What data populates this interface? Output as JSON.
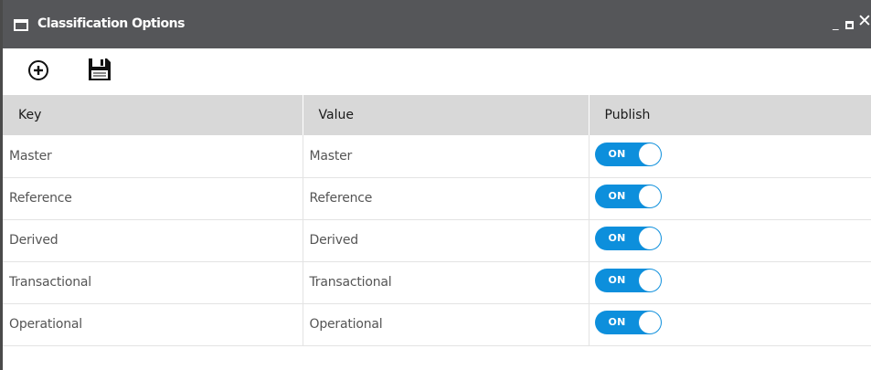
{
  "window": {
    "title": "Classification Options"
  },
  "toolbar": {
    "add_icon": "add-circle-icon",
    "save_icon": "floppy-disk-save-icon"
  },
  "table": {
    "columns": [
      "Key",
      "Value",
      "Publish"
    ],
    "rows": [
      {
        "key": "Master",
        "value": "Master",
        "publish": "ON"
      },
      {
        "key": "Reference",
        "value": "Reference",
        "publish": "ON"
      },
      {
        "key": "Derived",
        "value": "Derived",
        "publish": "ON"
      },
      {
        "key": "Transactional",
        "value": "Transactional",
        "publish": "ON"
      },
      {
        "key": "Operational",
        "value": "Operational",
        "publish": "ON"
      }
    ]
  },
  "colors": {
    "titlebar": "#555659",
    "header": "#d8d8d8",
    "toggle_on": "#0d8fdc"
  }
}
